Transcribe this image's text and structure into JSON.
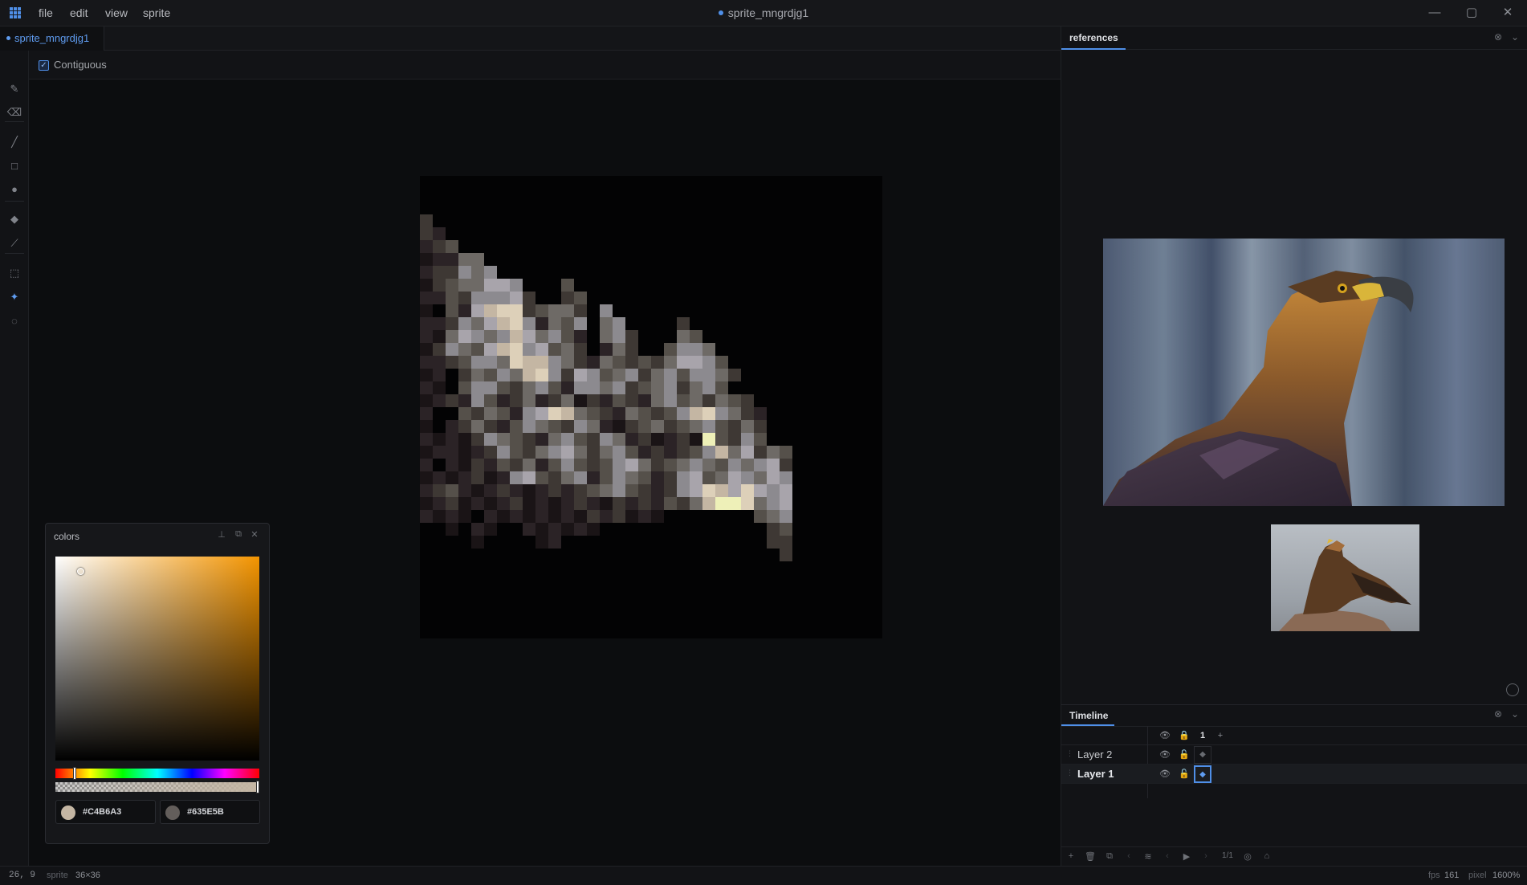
{
  "window": {
    "menus": [
      "file",
      "edit",
      "view",
      "sprite"
    ],
    "title": "sprite_mngrdjg1",
    "controls": [
      "—",
      "▢",
      "✕"
    ]
  },
  "tabs": {
    "document": "sprite_mngrdjg1"
  },
  "options": {
    "contiguous_label": "Contiguous",
    "contiguous_checked": true
  },
  "tools": [
    {
      "name": "pencil-icon",
      "glyph": "✎"
    },
    {
      "name": "eraser-icon",
      "glyph": "⌫"
    },
    {
      "name": "line-icon",
      "glyph": "╱"
    },
    {
      "name": "rectangle-icon",
      "glyph": "□"
    },
    {
      "name": "ellipse-icon",
      "glyph": "●"
    },
    {
      "name": "bucket-fill-icon",
      "glyph": "◆"
    },
    {
      "name": "eyedropper-icon",
      "glyph": "⟋"
    },
    {
      "name": "marquee-icon",
      "glyph": "⬚"
    },
    {
      "name": "magic-wand-icon",
      "glyph": "✦"
    },
    {
      "name": "lasso-icon",
      "glyph": "◌"
    }
  ],
  "active_tool": "magic-wand-icon",
  "colors_panel": {
    "title": "colors",
    "primary_color": "#C4B6A3",
    "secondary_color": "#635E5B",
    "hue_color": "#f39400"
  },
  "references": {
    "tab_label": "references"
  },
  "timeline": {
    "tab_label": "Timeline",
    "frame_number": "1",
    "add_frame": "+",
    "layers": [
      {
        "name": "Layer 2",
        "selected": false
      },
      {
        "name": "Layer 1",
        "selected": true
      }
    ],
    "frame_counter": "1/1"
  },
  "status": {
    "cursor": "26, 9",
    "sprite_label": "sprite",
    "sprite_size": "36×36",
    "fps_label": "fps",
    "fps": "161",
    "pixel_label": "pixel",
    "zoom": "1600%"
  },
  "palette": [
    "#030304",
    "#1a1416",
    "#2b2326",
    "#3e3834",
    "#55504a",
    "#6e6a66",
    "#8c8a8f",
    "#a8a4ab",
    "#c4b6a3",
    "#ddd0b9",
    "#eef0b8"
  ]
}
